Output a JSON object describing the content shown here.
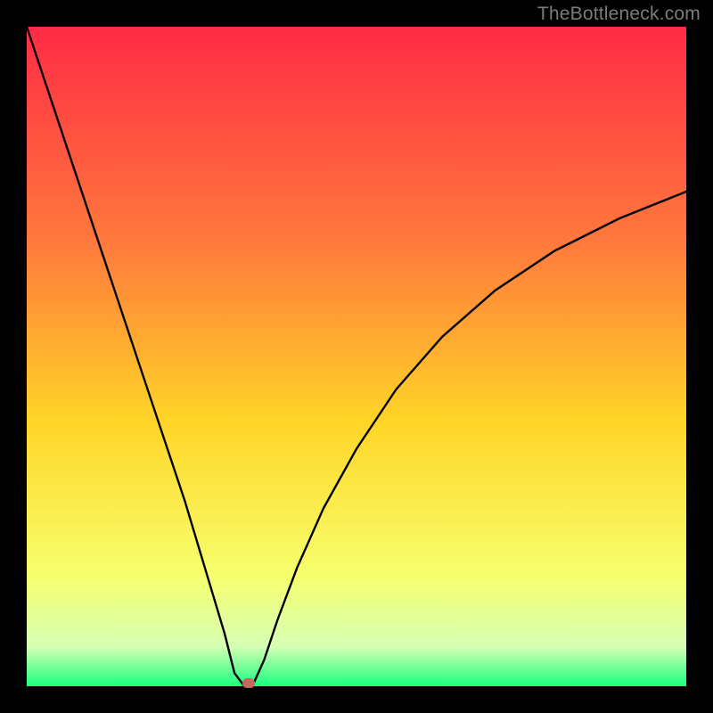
{
  "watermark": "TheBottleneck.com",
  "colors": {
    "top": "#ff2b45",
    "mid1": "#ff7a3c",
    "mid2": "#ffd527",
    "mid3": "#f7ff6d",
    "mid4": "#d6ffb4",
    "bottom": "#18ff7e",
    "frame": "#000000",
    "curve": "#000000",
    "marker": "#c06a60"
  },
  "chart_data": {
    "type": "line",
    "title": "",
    "xlabel": "",
    "ylabel": "",
    "xlim": [
      0,
      100
    ],
    "ylim": [
      0,
      100
    ],
    "series": [
      {
        "name": "bottleneck-curve",
        "x": [
          0,
          3,
          6,
          9,
          12,
          15,
          18,
          21,
          24,
          27,
          30,
          31.5,
          33,
          34.2,
          36,
          38,
          41,
          45,
          50,
          56,
          63,
          71,
          80,
          90,
          100
        ],
        "y": [
          100,
          91,
          82,
          73,
          64,
          55,
          46,
          37,
          28,
          18,
          8,
          2,
          0,
          0,
          4,
          10,
          18,
          27,
          36,
          45,
          53,
          60,
          66,
          71,
          75
        ]
      },
      {
        "name": "optimum-marker",
        "x": [
          33.6
        ],
        "y": [
          0.5
        ]
      }
    ],
    "legend": false,
    "grid": false
  }
}
